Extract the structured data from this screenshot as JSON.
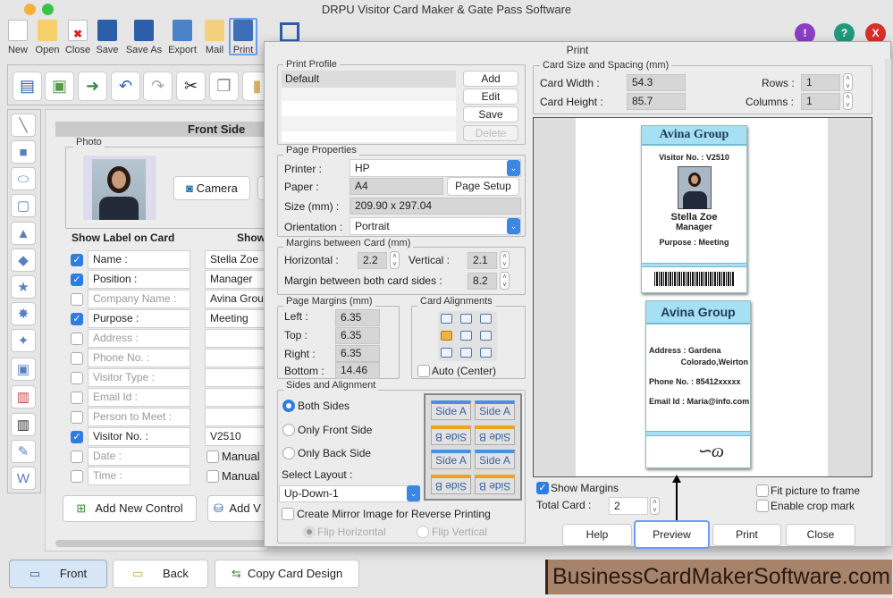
{
  "app": {
    "title": "DRPU Visitor Card Maker & Gate Pass Software"
  },
  "toolbar": {
    "items": [
      {
        "label": "New",
        "icon": "new-file-icon"
      },
      {
        "label": "Open",
        "icon": "open-folder-icon"
      },
      {
        "label": "Close",
        "icon": "close-file-icon"
      },
      {
        "label": "Save",
        "icon": "save-icon"
      },
      {
        "label": "Save As",
        "icon": "save-as-icon"
      },
      {
        "label": "Export",
        "icon": "export-icon"
      },
      {
        "label": "Mail",
        "icon": "mail-icon"
      },
      {
        "label": "Print",
        "icon": "printer-icon"
      }
    ]
  },
  "main": {
    "header": "Front Side",
    "photo_label": "Photo",
    "camera_label": "Camera",
    "show_label_heading": "Show Label on Card",
    "show_value_heading": "Show",
    "rows": [
      {
        "label": "Name :",
        "checked": true,
        "value": "Stella Zoe"
      },
      {
        "label": "Position :",
        "checked": true,
        "value": "Manager"
      },
      {
        "label": "Company Name :",
        "checked": false,
        "value": "Avina Grou"
      },
      {
        "label": "Purpose :",
        "checked": true,
        "value": "Meeting"
      },
      {
        "label": "Address :",
        "checked": false,
        "value": ""
      },
      {
        "label": "Phone No. :",
        "checked": false,
        "value": ""
      },
      {
        "label": "Visitor Type :",
        "checked": false,
        "value": ""
      },
      {
        "label": "Email Id :",
        "checked": false,
        "value": ""
      },
      {
        "label": "Person to Meet :",
        "checked": false,
        "value": ""
      },
      {
        "label": "Visitor No. :",
        "checked": true,
        "value": "V2510"
      },
      {
        "label": "Date :",
        "checked": false,
        "value": "Manual"
      },
      {
        "label": "Time :",
        "checked": false,
        "value": "Manual"
      }
    ],
    "add_new_control": "Add New Control",
    "add_label": "Add V"
  },
  "bottom": {
    "front": "Front",
    "back": "Back",
    "copy": "Copy Card Design"
  },
  "watermark": "BusinessCardMakerSoftware.com",
  "dialog": {
    "title": "Print",
    "print_profile": {
      "legend": "Print Profile",
      "items": [
        "Default"
      ],
      "add": "Add",
      "edit": "Edit",
      "save": "Save",
      "delete": "Delete"
    },
    "page_properties": {
      "legend": "Page Properties",
      "printer_label": "Printer :",
      "printer": "HP",
      "paper_label": "Paper :",
      "paper": "A4",
      "page_setup": "Page Setup",
      "size_label": "Size (mm) :",
      "size": "209.90 x 297.04",
      "orientation_label": "Orientation :",
      "orientation": "Portrait"
    },
    "margins_between": {
      "legend": "Margins between Card (mm)",
      "horizontal_label": "Horizontal :",
      "horizontal": "2.2",
      "vertical_label": "Vertical :",
      "vertical": "2.1",
      "both_label": "Margin between both card sides :",
      "both": "8.2"
    },
    "page_margins": {
      "legend": "Page Margins (mm)",
      "left_label": "Left :",
      "left": "6.35",
      "top_label": "Top :",
      "top": "6.35",
      "right_label": "Right :",
      "right": "6.35",
      "bottom_label": "Bottom :",
      "bottom": "14.46"
    },
    "card_alignments": {
      "legend": "Card Alignments",
      "selected": "middle-left",
      "auto_label": "Auto (Center)",
      "auto": false
    },
    "sides": {
      "legend": "Sides and Alignment",
      "both": "Both Sides",
      "front": "Only Front Side",
      "back": "Only Back Side",
      "selected": "Both Sides",
      "layout_label": "Select Layout :",
      "layout": "Up-Down-1",
      "side_a": "Side A",
      "side_b": "Side B",
      "mirror_label": "Create Mirror Image for Reverse Printing",
      "flip_h": "Flip Horizontal",
      "flip_v": "Flip Vertical"
    },
    "card_size": {
      "legend": "Card Size and Spacing (mm)",
      "width_label": "Card Width :",
      "width": "54.3",
      "height_label": "Card Height :",
      "height": "85.7",
      "rows_label": "Rows :",
      "rows": "1",
      "columns_label": "Columns :",
      "columns": "1"
    },
    "preview": {
      "front": {
        "company": "Avina Group",
        "visitor": "Visitor No. :  V2510",
        "name": "Stella Zoe",
        "position": "Manager",
        "purpose": "Purpose :  Meeting"
      },
      "back": {
        "company": "Avina Group",
        "address1": "Address :    Gardena",
        "address2": "Colorado,Weirton",
        "phone": "Phone No. : 85412xxxxx",
        "email": "Email Id : Maria@info.com"
      }
    },
    "show_margins": "Show Margins",
    "show_margins_checked": true,
    "total_card_label": "Total Card :",
    "total_card": "2",
    "fit_picture": "Fit picture to frame",
    "crop_mark": "Enable crop mark",
    "buttons": {
      "help": "Help",
      "preview": "Preview",
      "print": "Print",
      "close": "Close"
    }
  }
}
